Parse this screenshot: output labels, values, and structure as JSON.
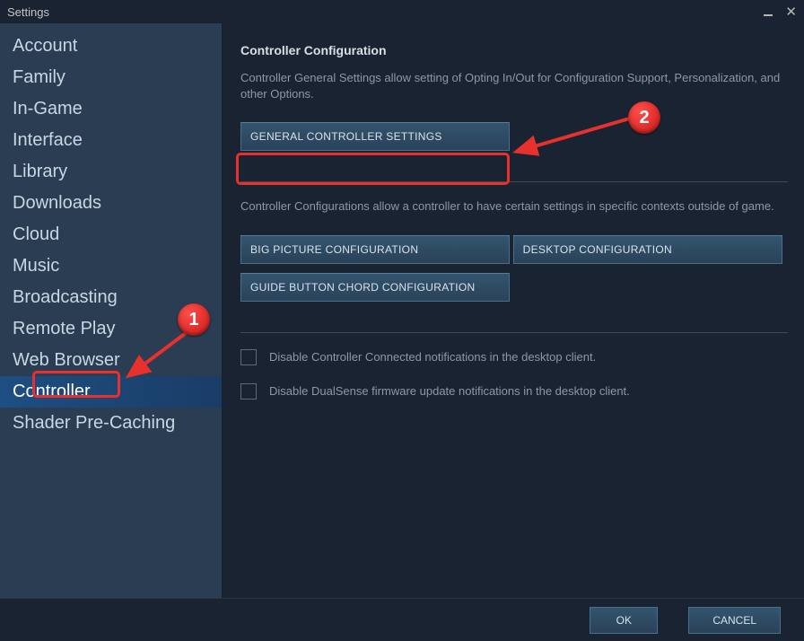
{
  "window": {
    "title": "Settings"
  },
  "sidebar": {
    "items": [
      {
        "label": "Account"
      },
      {
        "label": "Family"
      },
      {
        "label": "In-Game"
      },
      {
        "label": "Interface"
      },
      {
        "label": "Library"
      },
      {
        "label": "Downloads"
      },
      {
        "label": "Cloud"
      },
      {
        "label": "Music"
      },
      {
        "label": "Broadcasting"
      },
      {
        "label": "Remote Play"
      },
      {
        "label": "Web Browser"
      },
      {
        "label": "Controller",
        "active": true
      },
      {
        "label": "Shader Pre-Caching"
      }
    ]
  },
  "content": {
    "section1": {
      "title": "Controller Configuration",
      "description": "Controller General Settings allow setting of Opting In/Out for Configuration Support, Personalization, and other Options.",
      "button": "GENERAL CONTROLLER SETTINGS"
    },
    "section2": {
      "description": "Controller Configurations allow a controller to have certain settings in specific contexts outside of game.",
      "buttons": [
        "BIG PICTURE CONFIGURATION",
        "DESKTOP CONFIGURATION",
        "GUIDE BUTTON CHORD CONFIGURATION"
      ]
    },
    "section3": {
      "checkboxes": [
        "Disable Controller Connected notifications in the desktop client.",
        "Disable DualSense firmware update notifications in the desktop client."
      ]
    }
  },
  "footer": {
    "ok": "OK",
    "cancel": "CANCEL"
  },
  "annotations": {
    "badge1": "1",
    "badge2": "2"
  }
}
